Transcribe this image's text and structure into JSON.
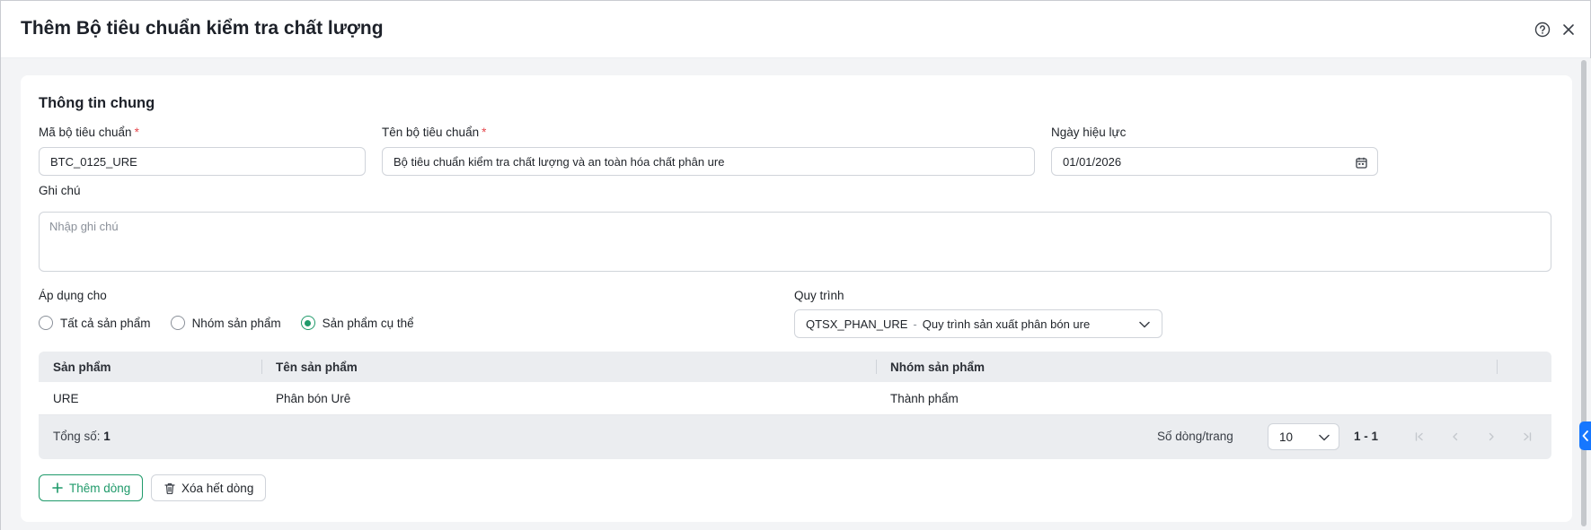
{
  "dialog": {
    "title": "Thêm Bộ tiêu chuẩn kiểm tra chất lượng",
    "help_icon": "help-circle-icon",
    "close_icon": "close-icon"
  },
  "general": {
    "section_title": "Thông tin chung",
    "code": {
      "label": "Mã bộ tiêu chuẩn",
      "required_mark": "*",
      "value": "BTC_0125_URE"
    },
    "name": {
      "label": "Tên bộ tiêu chuẩn",
      "required_mark": "*",
      "value": "Bộ tiêu chuẩn kiểm tra chất lượng và an toàn hóa chất phân ure"
    },
    "effective_date": {
      "label": "Ngày hiệu lực",
      "value": "01/01/2026",
      "icon": "calendar-icon"
    },
    "note": {
      "label": "Ghi chú",
      "placeholder": "Nhập ghi chú"
    }
  },
  "apply_for": {
    "label": "Áp dụng cho",
    "options": [
      "Tất cả sản phẩm",
      "Nhóm sản phẩm",
      "Sản phẩm cụ thể"
    ],
    "selected": "Sản phẩm cụ thể"
  },
  "process": {
    "label": "Quy trình",
    "code": "QTSX_PHAN_URE",
    "separator": "-",
    "name": "Quy trình sản xuất phân bón ure"
  },
  "grid": {
    "columns": [
      "Sản phẩm",
      "Tên sản phẩm",
      "Nhóm sản phẩm"
    ],
    "rows": [
      [
        "URE",
        "Phân bón Urê",
        "Thành phẩm"
      ]
    ],
    "footer": {
      "total_label": "Tổng số:",
      "total_value": "1",
      "rows_per_page_label": "Số dòng/trang",
      "rows_per_page": "10",
      "range": "1 - 1"
    }
  },
  "actions": {
    "add_row": "Thêm dòng",
    "clear_rows": "Xóa hết dòng"
  },
  "colors": {
    "accent": "#1f9a6a",
    "required": "#e5484d",
    "side_tab": "#1677ff"
  }
}
